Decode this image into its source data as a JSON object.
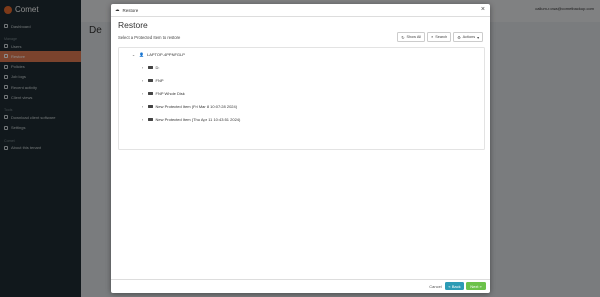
{
  "app": {
    "name": "Comet"
  },
  "sidebar": {
    "items_top": [
      {
        "label": "Dashboard"
      }
    ],
    "section_manage": "Manage",
    "items_manage": [
      {
        "label": "Users"
      },
      {
        "label": "Restore",
        "active": true
      },
      {
        "label": "Policies"
      },
      {
        "label": "Job logs"
      },
      {
        "label": "Recent activity"
      },
      {
        "label": "Client views"
      }
    ],
    "section_tools": "Tools",
    "items_tools": [
      {
        "label": "Download client software"
      },
      {
        "label": "Settings"
      }
    ],
    "section_comet": "Comet",
    "items_comet": [
      {
        "label": "About this tenant"
      }
    ]
  },
  "header": {
    "user": "callum-r.cwa@cometbackup.com"
  },
  "page": {
    "title": "De"
  },
  "modal": {
    "window_title": "Restore",
    "close": "×",
    "title": "Restore",
    "subtitle": "Select a Protected Item to restore",
    "toolbar": {
      "show_all": "Show All",
      "search": "Search",
      "actions": "Actions"
    },
    "tree": {
      "root": "LAPTOP-4PPNFGLP",
      "items": [
        {
          "label": "D:"
        },
        {
          "label": "FNP"
        },
        {
          "label": "FNP Whole Disk"
        },
        {
          "label": "New Protected Item (Fri Mar 8 10:07:28 2024)"
        },
        {
          "label": "New Protected Item (Thu Apr 11 10:43:51 2024)"
        }
      ]
    },
    "footer": {
      "cancel": "Cancel",
      "back": "« Back",
      "next": "Next »"
    },
    "progress_fraction": 0.14
  },
  "colors": {
    "accent": "#e07b53",
    "back_button": "#2c9bb5",
    "next_button": "#6cc24a",
    "progress": "#2a9fd6"
  }
}
